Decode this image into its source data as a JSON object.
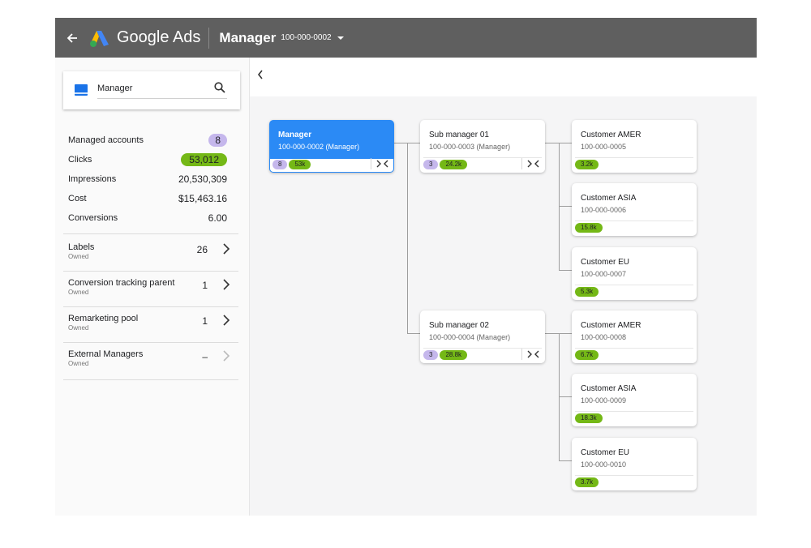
{
  "topbar": {
    "brand": "Google Ads",
    "account_name": "Manager",
    "account_id": "100-000-0002"
  },
  "search": {
    "value": "Manager"
  },
  "stats": [
    {
      "label": "Managed accounts",
      "value": "8",
      "style": "purple"
    },
    {
      "label": "Clicks",
      "value": "53,012",
      "style": "green"
    },
    {
      "label": "Impressions",
      "value": "20,530,309",
      "style": "plain"
    },
    {
      "label": "Cost",
      "value": "$15,463.16",
      "style": "plain"
    },
    {
      "label": "Conversions",
      "value": "6.00",
      "style": "plain"
    }
  ],
  "properties": [
    {
      "name": "Labels",
      "sub": "Owned",
      "value": "26"
    },
    {
      "name": "Conversion tracking parent",
      "sub": "Owned",
      "value": "1"
    },
    {
      "name": "Remarketing pool",
      "sub": "Owned",
      "value": "1"
    },
    {
      "name": "External Managers",
      "sub": "Owned",
      "value": "–"
    }
  ],
  "tree": {
    "root": {
      "name": "Manager",
      "id": "100-000-0002 (Manager)",
      "count": "8",
      "clicks": "53k"
    },
    "sub1": {
      "name": "Sub manager 01",
      "id": "100-000-0003 (Manager)",
      "count": "3",
      "clicks": "24.2k"
    },
    "sub2": {
      "name": "Sub manager 02",
      "id": "100-000-0004 (Manager)",
      "count": "3",
      "clicks": "28.8k"
    },
    "customers": [
      {
        "name": "Customer AMER",
        "id": "100-000-0005",
        "clicks": "3.2k"
      },
      {
        "name": "Customer ASIA",
        "id": "100-000-0006",
        "clicks": "15.8k"
      },
      {
        "name": "Customer EU",
        "id": "100-000-0007",
        "clicks": "5.3k"
      },
      {
        "name": "Customer AMER",
        "id": "100-000-0008",
        "clicks": "6.7k"
      },
      {
        "name": "Customer ASIA",
        "id": "100-000-0009",
        "clicks": "18.3k"
      },
      {
        "name": "Customer EU",
        "id": "100-000-0010",
        "clicks": "3.7k"
      }
    ]
  },
  "colors": {
    "topbar": "#5f5f5f",
    "selected_card": "#2b8af5",
    "badge_purple": "#c5b7ec",
    "badge_green": "#74b816"
  }
}
